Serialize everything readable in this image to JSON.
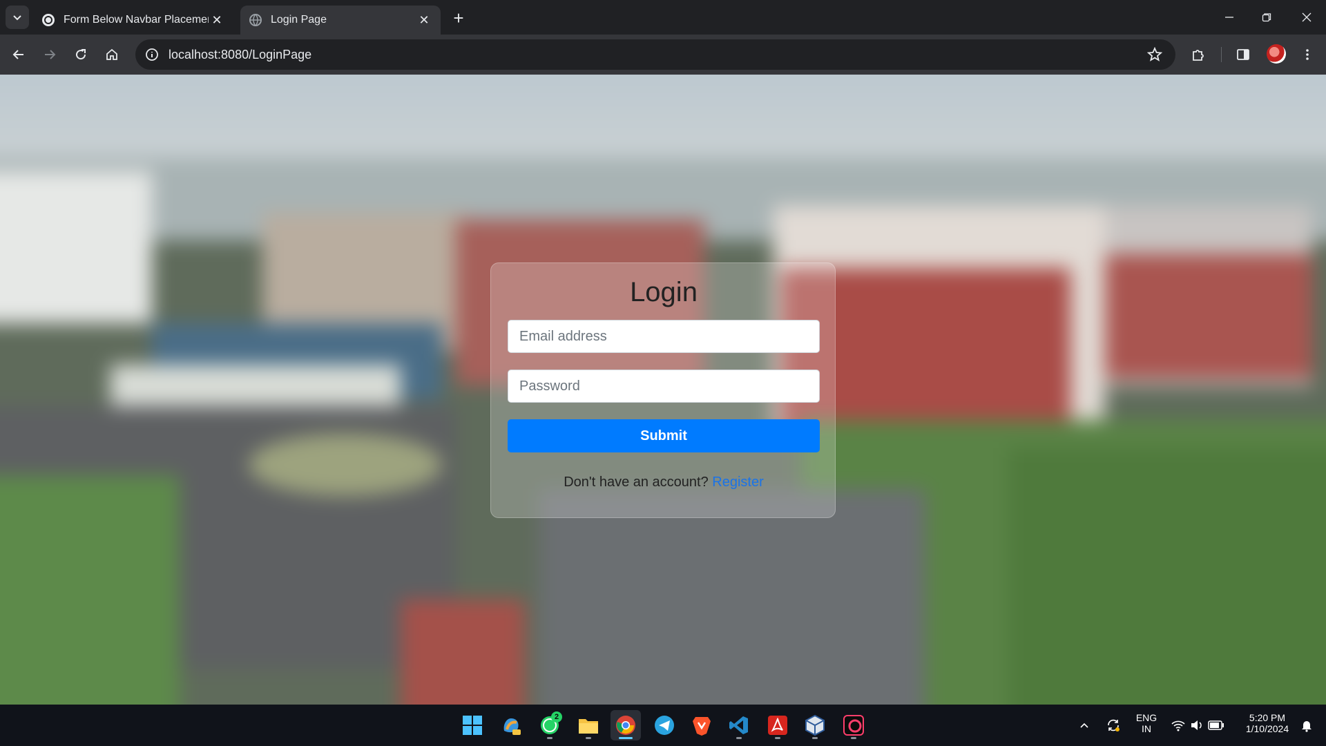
{
  "browser": {
    "tabs": [
      {
        "title": "Form Below Navbar Placement",
        "active": false
      },
      {
        "title": "Login Page",
        "active": true
      }
    ],
    "url": "localhost:8080/LoginPage"
  },
  "login": {
    "title": "Login",
    "email_placeholder": "Email address",
    "password_placeholder": "Password",
    "submit_label": "Submit",
    "register_prompt": "Don't have an account?",
    "register_link": "Register"
  },
  "taskbar": {
    "apps": [
      "start-icon",
      "copilot-icon",
      "whatsapp-icon",
      "file-explorer-icon",
      "chrome-icon",
      "telegram-icon",
      "brave-icon",
      "vscode-icon",
      "acrobat-icon",
      "virtualbox-icon",
      "app-icon"
    ],
    "whatsapp_badge": "2",
    "language_line1": "ENG",
    "language_line2": "IN",
    "time": "5:20 PM",
    "date": "1/10/2024"
  },
  "colors": {
    "submit": "#007bff",
    "link": "#1a73e8",
    "tab_active": "#35363a",
    "chrome_dark": "#202124"
  }
}
